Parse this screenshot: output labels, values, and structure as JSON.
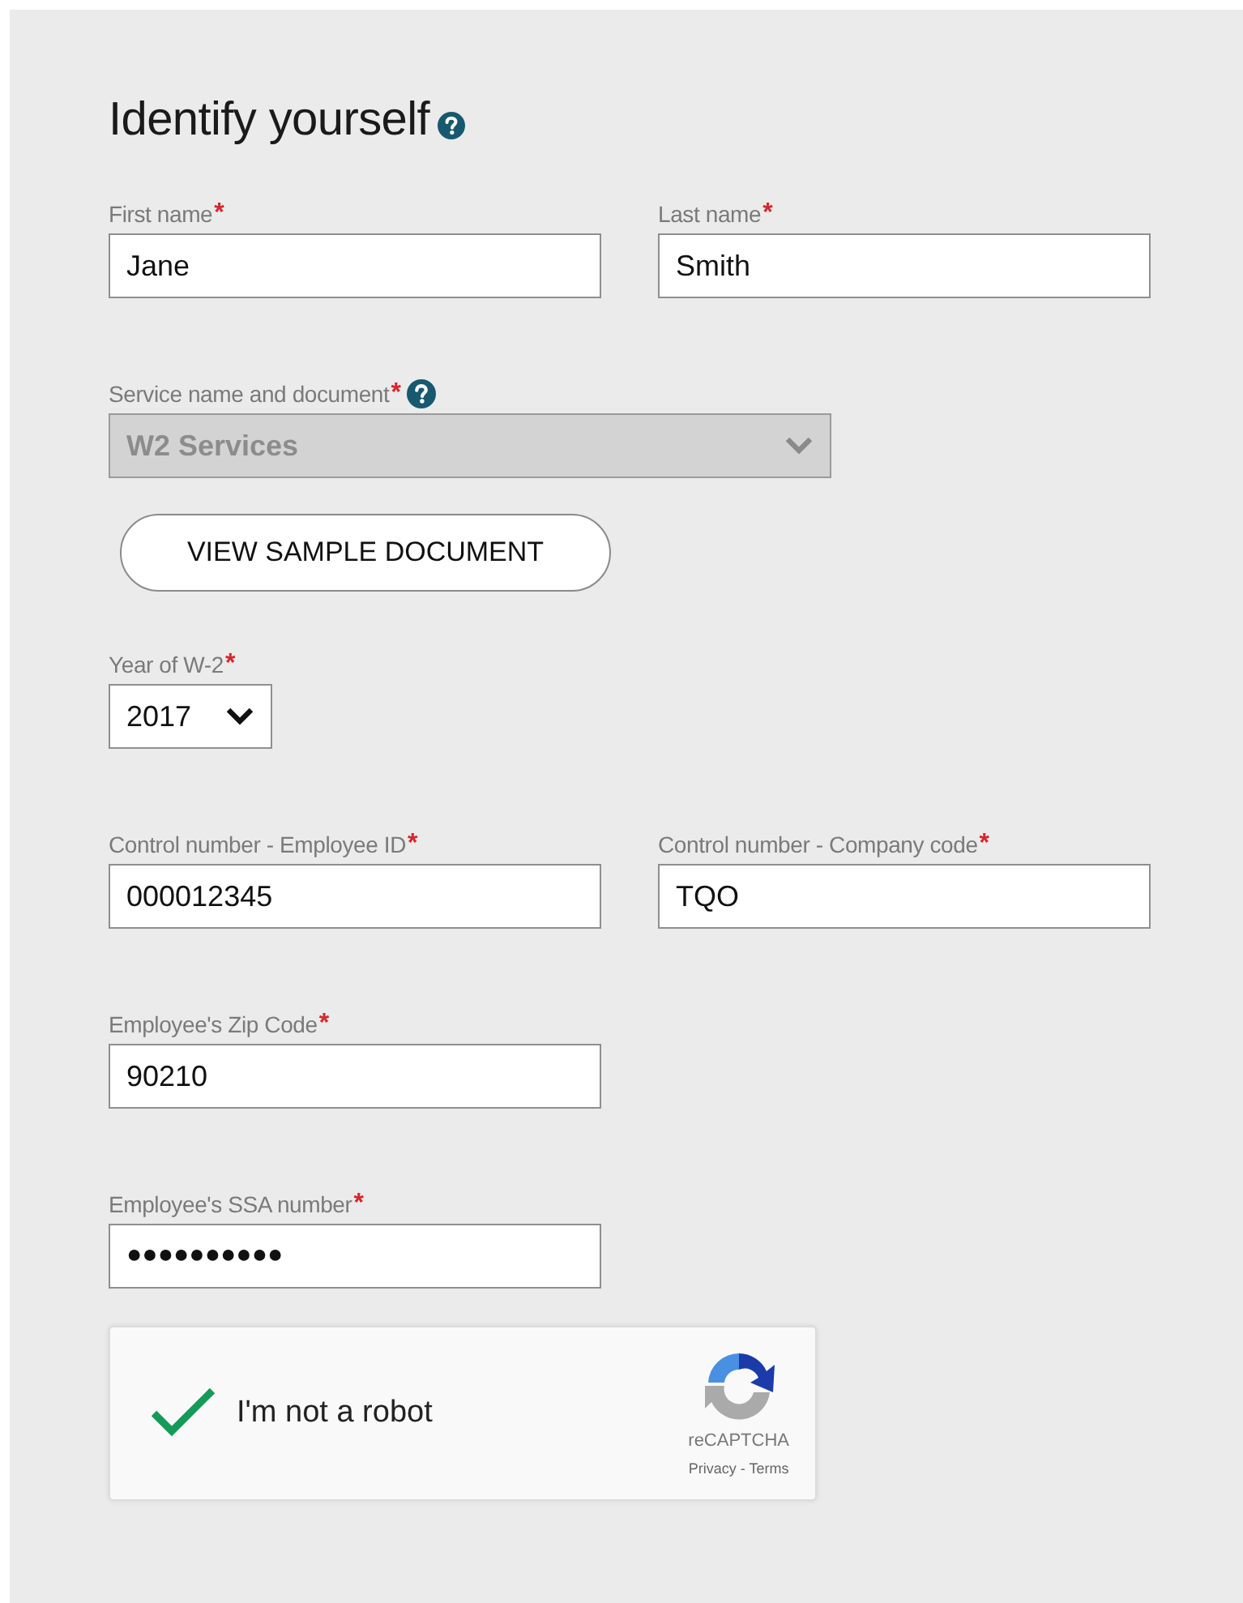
{
  "title": "Identify yourself",
  "title_help": true,
  "sections": [
    {
      "kind": "fields",
      "fields": [
        {
          "kind": "text",
          "label": "First name",
          "mark": "*",
          "value": "Jane"
        },
        {
          "kind": "text",
          "label": "Last name",
          "mark": "*",
          "value": "Smith"
        }
      ]
    },
    {
      "kind": "fields",
      "fields": [
        {
          "kind": "dropdown",
          "label": "Service name and document",
          "mark": "*",
          "help": true,
          "value": "W2 Services",
          "disabled": true
        }
      ]
    },
    {
      "kind": "button",
      "label": "VIEW SAMPLE DOCUMENT"
    },
    {
      "kind": "fields",
      "fields": [
        {
          "kind": "compact_dropdown",
          "label": "Year of W-2",
          "mark": "*",
          "value": "2017"
        }
      ]
    },
    {
      "kind": "fields",
      "fields": [
        {
          "kind": "text",
          "label": "Control number - Employee ID",
          "mark": "*",
          "value": "000012345"
        },
        {
          "kind": "text",
          "label": "Control number - Company code",
          "mark": "*",
          "value": "TQO"
        }
      ]
    },
    {
      "kind": "fields",
      "fields": [
        {
          "kind": "text",
          "label": "Employee's Zip Code",
          "mark": "*",
          "value": "90210"
        }
      ]
    },
    {
      "kind": "fields",
      "fields": [
        {
          "kind": "password",
          "label": "Employee's SSA number",
          "mark": "*",
          "value": "●●●●●●●●●●"
        }
      ]
    },
    {
      "kind": "captcha",
      "checked": true,
      "label": "I'm not a robot",
      "brand": "reCAPTCHA",
      "links": "Privacy - Terms"
    }
  ]
}
